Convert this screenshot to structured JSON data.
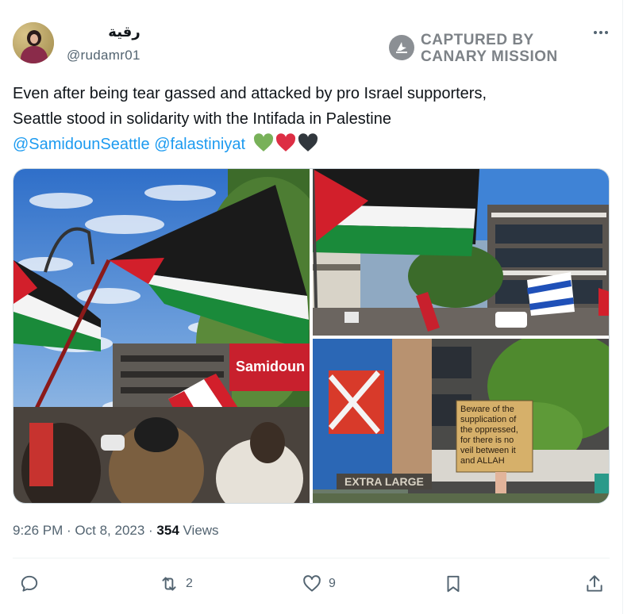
{
  "user": {
    "display_name": "رقية",
    "handle": "@rudamr01"
  },
  "watermark": {
    "line1": "CAPTURED BY",
    "line2": "CANARY MISSION",
    "icon": "canary-mission-icon"
  },
  "tweet": {
    "line1": "Even after being tear gassed and attacked by pro Israel supporters,",
    "line2": "Seattle stood in solidarity with the Intifada in Palestine",
    "mention1": "@SamidounSeattle",
    "mention2": "@falastiniyat",
    "hearts": [
      "#78b159",
      "#dd2e44",
      "#31373d"
    ]
  },
  "media": {
    "photo1_banner": "Samidoun",
    "photo3_sign": [
      "Beware of the",
      "supplication of",
      "the oppressed,",
      "for there is no",
      "veil between it",
      "and ALLAH"
    ],
    "photo3_box": "EXTRA LARGE"
  },
  "meta": {
    "time": "9:26 PM · Oct 8, 2023 · ",
    "views_count": "354",
    "views_label": " Views"
  },
  "actions": {
    "retweets": "2",
    "likes": "9"
  },
  "colors": {
    "accent": "#1d9bf0",
    "secondary_text": "#536471"
  }
}
